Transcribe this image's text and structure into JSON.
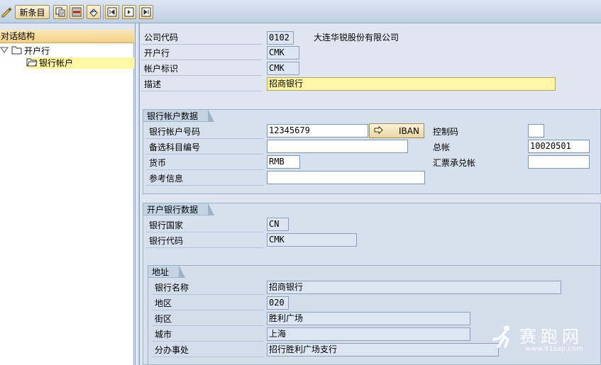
{
  "toolbar": {
    "new_entries_label": "新条目",
    "icons": [
      "edit-icon",
      "copy-icon",
      "delete-icon",
      "undo-icon",
      "first-page-icon",
      "next-page-icon",
      "last-page-icon"
    ]
  },
  "tree": {
    "header": "对话结构",
    "items": [
      {
        "label": "开户行",
        "level": 0,
        "icon": "folder-open-icon"
      },
      {
        "label": "银行帐户",
        "level": 1,
        "icon": "folder-open-icon"
      }
    ]
  },
  "header": {
    "company_code_label": "公司代码",
    "company_code_value": "0102",
    "company_name": "大连华锐股份有限公司",
    "house_bank_label": "开户行",
    "house_bank_value": "CMK",
    "account_id_label": "帐户标识",
    "account_id_value": "CMK",
    "description_label": "描述",
    "description_value": "招商银行"
  },
  "bank_account_data": {
    "title": "银行帐户数据",
    "account_number_label": "银行帐户号码",
    "account_number_value": "12345679",
    "iban_label": "IBAN",
    "control_key_label": "控制码",
    "control_key_value": "",
    "alt_account_label": "备选科目编号",
    "alt_account_value": "",
    "gl_account_label": "总帐",
    "gl_account_value": "10020501",
    "currency_label": "货币",
    "currency_value": "RMB",
    "bill_account_label": "汇票承兑帐",
    "bill_account_value": "",
    "reference_label": "参考信息",
    "reference_value": ""
  },
  "house_bank_data": {
    "title": "开户银行数据",
    "country_label": "银行国家",
    "country_value": "CN",
    "bank_key_label": "银行代码",
    "bank_key_value": "CMK"
  },
  "address": {
    "title": "地址",
    "bank_name_label": "银行名称",
    "bank_name_value": "招商银行",
    "region_label": "地区",
    "region_value": "020",
    "street_label": "街区",
    "street_value": "胜利广场",
    "city_label": "城市",
    "city_value": "上海",
    "branch_label": "分办事处",
    "branch_value": "招行胜利广场支行"
  },
  "watermark": {
    "text": "赛跑网",
    "url": "www.91sap.com"
  },
  "colors": {
    "background": "#dfe6ef",
    "button_face": "#f0dfae",
    "highlight_field": "#fff6a8",
    "tree_selection": "#fff7a3"
  }
}
